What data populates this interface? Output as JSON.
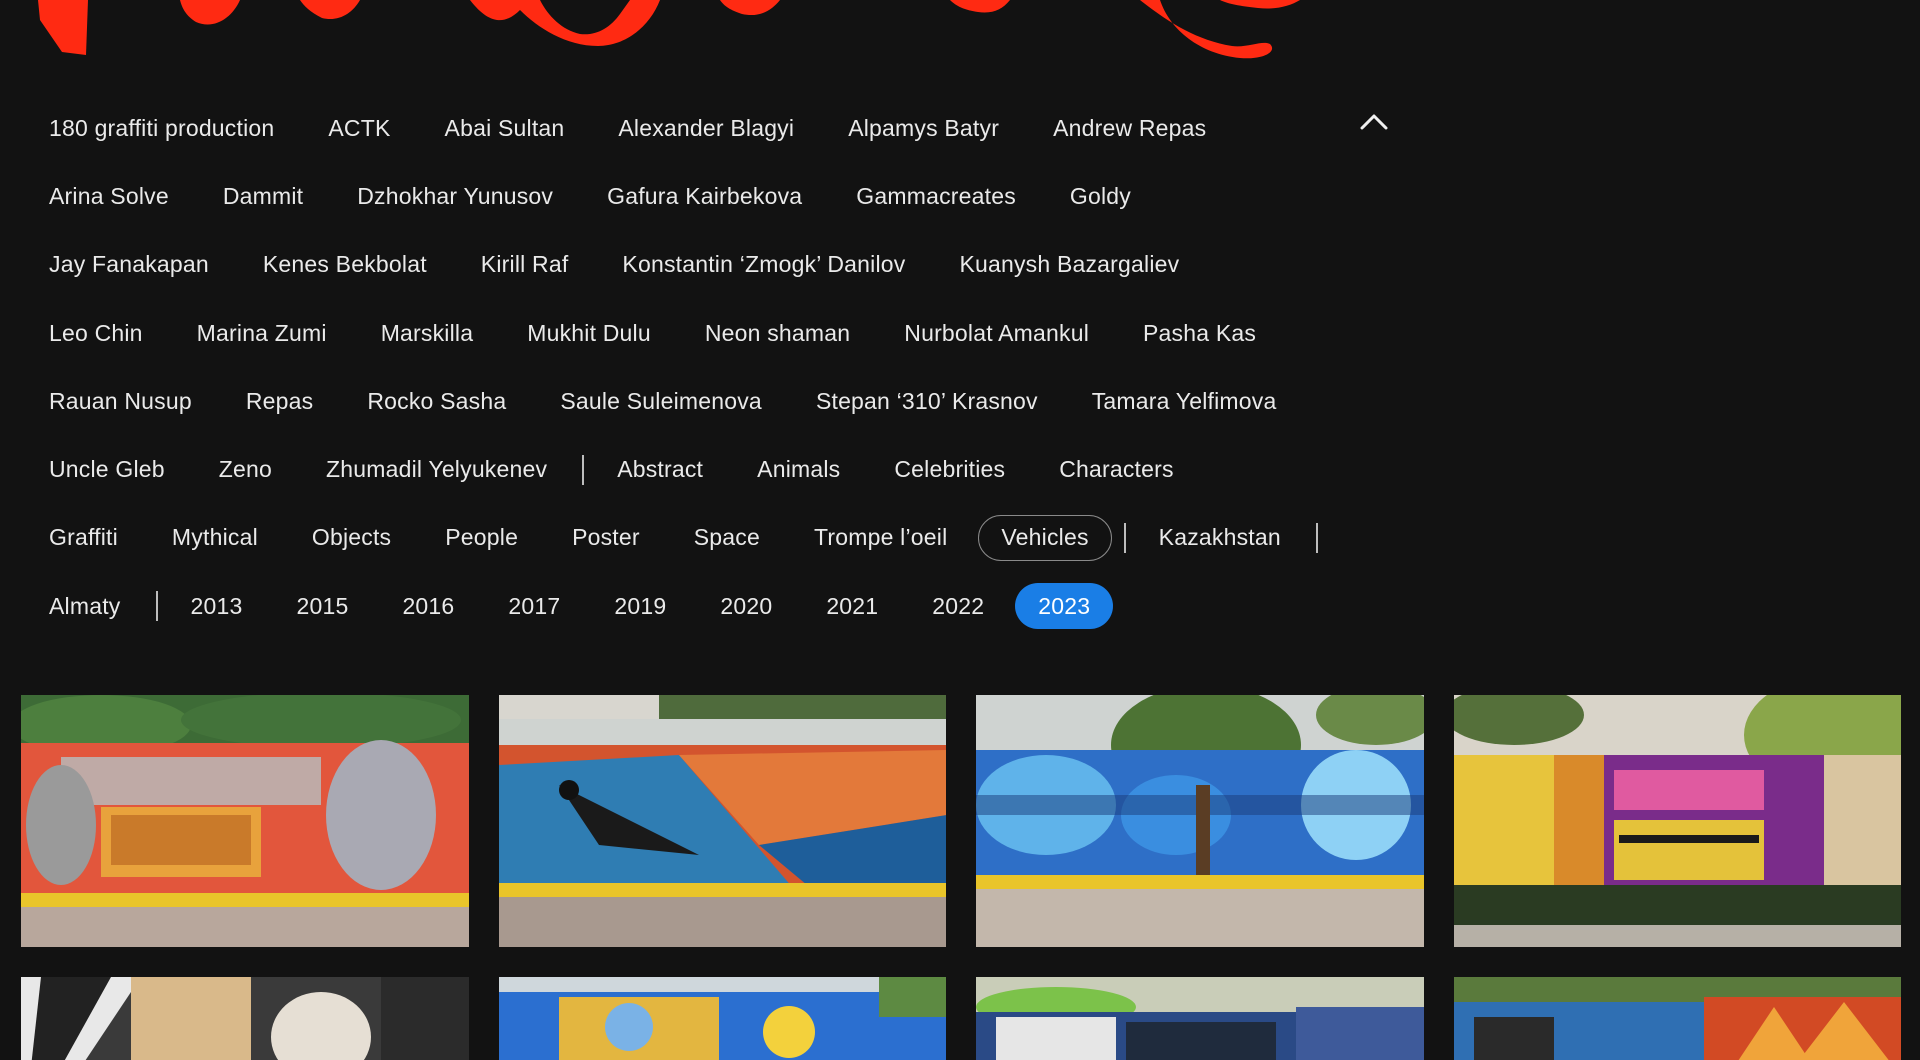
{
  "filters": {
    "rows": [
      [
        {
          "label": "180 graffiti production"
        },
        {
          "label": "ACTK"
        },
        {
          "label": "Abai Sultan"
        },
        {
          "label": "Alexander Blagyi"
        },
        {
          "label": "Alpamys Batyr"
        },
        {
          "label": "Andrew Repas"
        }
      ],
      [
        {
          "label": "Arina Solve"
        },
        {
          "label": "Dammit"
        },
        {
          "label": "Dzhokhar Yunusov"
        },
        {
          "label": "Gafura Kairbekova"
        },
        {
          "label": "Gammacreates"
        },
        {
          "label": "Goldy"
        }
      ],
      [
        {
          "label": "Jay Fanakapan"
        },
        {
          "label": "Kenes Bekbolat"
        },
        {
          "label": "Kirill Raf"
        },
        {
          "label": "Konstantin ‘Zmogk’ Danilov"
        },
        {
          "label": "Kuanysh Bazargaliev"
        }
      ],
      [
        {
          "label": "Leo Chin"
        },
        {
          "label": "Marina Zumi"
        },
        {
          "label": "Marskilla"
        },
        {
          "label": "Mukhit Dulu"
        },
        {
          "label": "Neon shaman"
        },
        {
          "label": "Nurbolat Amankul"
        },
        {
          "label": "Pasha Kas"
        }
      ],
      [
        {
          "label": "Rauan Nusup"
        },
        {
          "label": "Repas"
        },
        {
          "label": "Rocko Sasha"
        },
        {
          "label": "Saule Suleimenova"
        },
        {
          "label": "Stepan ‘310’ Krasnov"
        },
        {
          "label": "Tamara Yelfimova"
        }
      ],
      [
        {
          "label": "Uncle Gleb"
        },
        {
          "label": "Zeno"
        },
        {
          "label": "Zhumadil Yelyukenev"
        },
        {
          "sep": true
        },
        {
          "label": "Abstract"
        },
        {
          "label": "Animals"
        },
        {
          "label": "Celebrities"
        },
        {
          "label": "Characters"
        }
      ],
      [
        {
          "label": "Graffiti"
        },
        {
          "label": "Mythical"
        },
        {
          "label": "Objects"
        },
        {
          "label": "People"
        },
        {
          "label": "Poster"
        },
        {
          "label": "Space"
        },
        {
          "label": "Trompe l’oeil"
        },
        {
          "label": "Vehicles",
          "state": "outlined"
        },
        {
          "sep": true
        },
        {
          "label": "Kazakhstan"
        },
        {
          "sep": true
        }
      ],
      [
        {
          "label": "Almaty"
        },
        {
          "sep": true
        },
        {
          "label": "2013"
        },
        {
          "label": "2015"
        },
        {
          "label": "2016"
        },
        {
          "label": "2017"
        },
        {
          "label": "2019"
        },
        {
          "label": "2020"
        },
        {
          "label": "2021"
        },
        {
          "label": "2022"
        },
        {
          "label": "2023",
          "state": "active"
        }
      ]
    ],
    "collapse_icon": "chevron-up-icon"
  },
  "colors": {
    "background": "#121212",
    "logo_red": "#ff2a12",
    "active_chip": "#1a7ee6",
    "chip_text": "#eaeaea"
  },
  "gallery": {
    "rows": [
      [
        {
          "name": "thumb-rock-n-roll-mural"
        },
        {
          "name": "thumb-magpie-mural"
        },
        {
          "name": "thumb-blue-characters-mural"
        },
        {
          "name": "thumb-colorful-panels-mural"
        }
      ],
      [
        {
          "name": "thumb-statue-head-mural"
        },
        {
          "name": "thumb-sun-cartoon-mural"
        },
        {
          "name": "thumb-green-graffiti-mural"
        },
        {
          "name": "thumb-orange-leaves-mural"
        }
      ]
    ]
  }
}
